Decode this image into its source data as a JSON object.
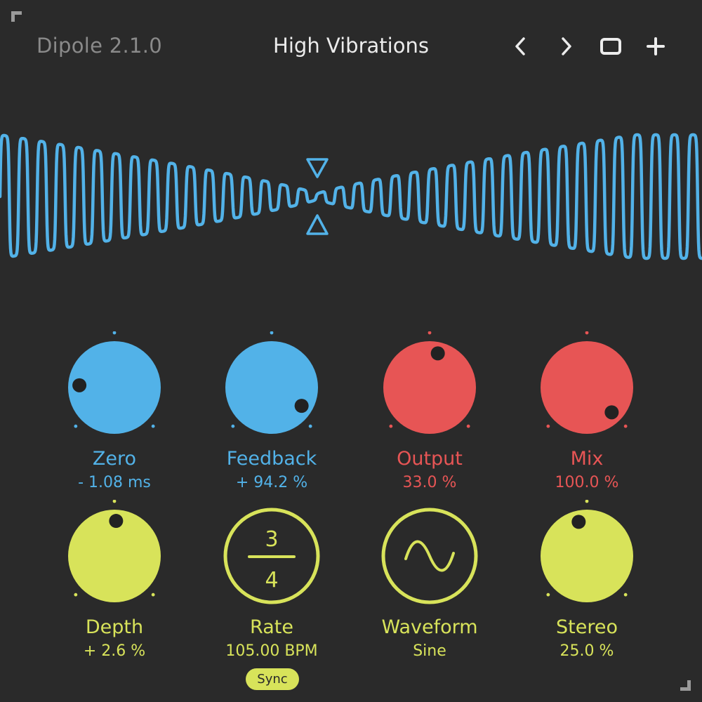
{
  "header": {
    "app_name": "Dipole 2.1.0",
    "preset_name": "High Vibrations",
    "buttons": [
      "prev-preset",
      "next-preset",
      "save-preset",
      "add-preset"
    ]
  },
  "colors": {
    "background": "#2a2a2a",
    "blue": "#52b2e8",
    "red": "#e75555",
    "yellow": "#d8e35a",
    "muted": "#8a8a8a"
  },
  "knobs": {
    "zero": {
      "label": "Zero",
      "value": "- 1.08 ms",
      "color": "blue",
      "position": 0.18
    },
    "feedback": {
      "label": "Feedback",
      "value": "+ 94.2 %",
      "color": "blue",
      "position": 0.95
    },
    "output": {
      "label": "Output",
      "value": "33.0 %",
      "color": "red",
      "position": 0.55
    },
    "mix": {
      "label": "Mix",
      "value": "100.0 %",
      "color": "red",
      "position": 1.0
    },
    "depth": {
      "label": "Depth",
      "value": "+ 2.6 %",
      "color": "yellow",
      "position": 0.51
    },
    "stereo": {
      "label": "Stereo",
      "value": "25.0 %",
      "color": "yellow",
      "position": 0.45
    }
  },
  "rate": {
    "label": "Rate",
    "value": "105.00 BPM",
    "numerator": "3",
    "denominator": "4",
    "sync_label": "Sync"
  },
  "waveform": {
    "label": "Waveform",
    "value": "Sine"
  }
}
